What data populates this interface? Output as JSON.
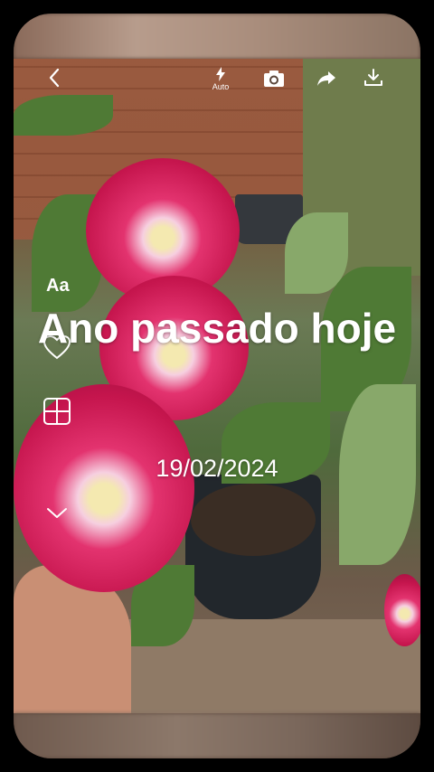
{
  "toolbar": {
    "back_icon": "chevron-left-icon",
    "flash_icon": "flash-icon",
    "flash_mode": "Auto",
    "camera_icon": "camera-icon",
    "share_icon": "share-icon",
    "download_icon": "download-icon"
  },
  "side_tools": {
    "text_style_label": "Aa",
    "favorite_icon": "heart-icon",
    "layout_icon": "layout-grid-icon",
    "more_icon": "chevron-down-icon"
  },
  "caption": {
    "title": "Ano passado hoje",
    "date": "19/02/2024"
  }
}
